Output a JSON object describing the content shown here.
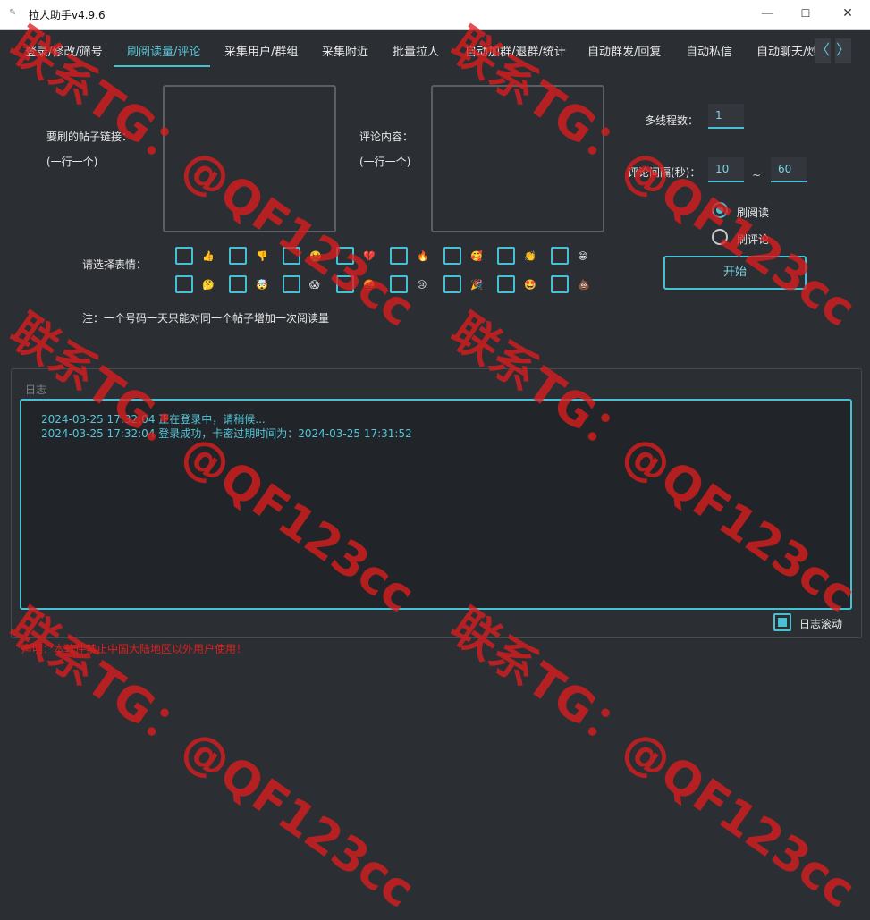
{
  "window": {
    "title": "拉人助手v4.9.6",
    "minimize": "—",
    "maximize": "☐",
    "close": "✕"
  },
  "tabs": [
    {
      "label": "登录/修改/筛号"
    },
    {
      "label": "刷阅读量/评论"
    },
    {
      "label": "采集用户/群组"
    },
    {
      "label": "采集附近"
    },
    {
      "label": "批量拉人"
    },
    {
      "label": "自动加群/退群/统计"
    },
    {
      "label": "自动群发/回复"
    },
    {
      "label": "自动私信"
    },
    {
      "label": "自动聊天/炒"
    }
  ],
  "active_tab": "刷阅读量/评论",
  "tab_nav": {
    "prev": "〈",
    "next": "〉"
  },
  "form": {
    "post_link_label": "要刷的帖子链接：",
    "post_link_hint": "(一行一个)",
    "post_link_value": "",
    "comment_label": "评论内容：",
    "comment_hint": "(一行一个)",
    "comment_value": "",
    "threads_label": "多线程数：",
    "threads_value": "1",
    "interval_label": "评论间隔(秒)：",
    "interval_min": "10",
    "interval_sep": "~",
    "interval_max": "60",
    "mode_options": [
      {
        "label": "刷阅读",
        "checked": true
      },
      {
        "label": "刷评论",
        "checked": false
      }
    ],
    "start_button": "开始",
    "emoji_label": "请选择表情：",
    "emojis_row1": [
      "👍",
      "👎",
      "🤮",
      "💔",
      "🔥",
      "🥰",
      "👏",
      "😁"
    ],
    "emojis_row2": [
      "🤔",
      "🤯",
      "😱",
      "🤬",
      "😢",
      "🎉",
      "🤩",
      "💩"
    ],
    "note": "注：一个号码一天只能对同一个帖子增加一次阅读量"
  },
  "log": {
    "title": "日志",
    "lines": [
      "2024-03-25 17:32:04 正在登录中，请稍候...",
      "2024-03-25 17:32:04 登录成功，卡密过期时间为：2024-03-25 17:31:52"
    ],
    "auto_scroll_label": "日志滚动",
    "auto_scroll_checked": true
  },
  "notice": "声明：本软件禁止中国大陆地区以外用户使用！",
  "watermark": "联系TG：@QF123cc",
  "colors": {
    "accent": "#48c0d4",
    "background": "#2b2e33",
    "notice": "#e01e1e",
    "watermark": "#dc1e1e"
  }
}
